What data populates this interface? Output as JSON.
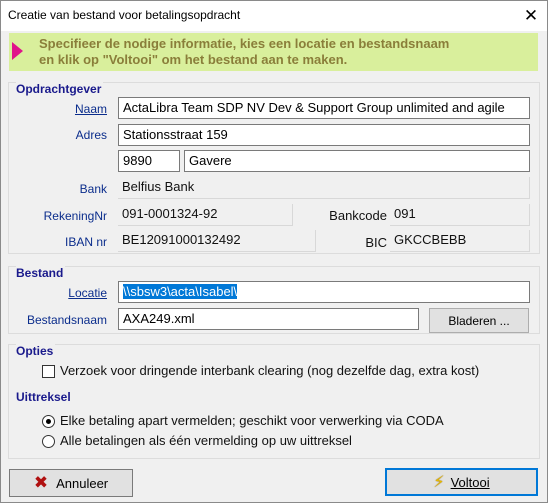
{
  "window": {
    "title": "Creatie van bestand voor betalingsopdracht"
  },
  "banner": {
    "text": "Specifieer de nodige informatie, kies een locatie en bestandsnaam\nen klik op \"Voltooi\" om het bestand aan te maken."
  },
  "opdrachtgever": {
    "title": "Opdrachtgever",
    "naam_label": "Naam",
    "naam_value": "ActaLibra Team SDP NV Dev & Support Group unlimited and agile",
    "adres_label": "Adres",
    "adres_value": "Stationsstraat 159",
    "postcode_value": "9890",
    "gemeente_value": "Gavere",
    "bank_label": "Bank",
    "bank_value": "Belfius Bank",
    "rekening_label": "RekeningNr",
    "rekening_value": "091-0001324-92",
    "bankcode_label": "Bankcode",
    "bankcode_value": "091",
    "iban_label": "IBAN nr",
    "iban_value": "BE12091000132492",
    "bic_label": "BIC",
    "bic_value": "GKCCBEBB"
  },
  "bestand": {
    "title": "Bestand",
    "locatie_label": "Locatie",
    "locatie_value": "\\\\sbsw3\\acta\\Isabel\\",
    "naam_label": "Bestandsnaam",
    "naam_value": "AXA249.xml",
    "browse_label": "Bladeren ..."
  },
  "opties": {
    "title": "Opties",
    "checkbox_label": "Verzoek voor dringende interbank clearing (nog dezelfde dag, extra kost)",
    "checkbox_checked": false
  },
  "uittreksel": {
    "title": "Uittreksel",
    "options": [
      {
        "label": "Elke betaling apart vermelden; geschikt voor verwerking via CODA",
        "selected": true
      },
      {
        "label": "Alle betalingen als één vermelding op uw uittreksel",
        "selected": false
      }
    ]
  },
  "footer": {
    "cancel_label": "Annuleer",
    "finish_label": "Voltooi"
  },
  "icons": {
    "close": "close-icon",
    "arrow": "arrow-icon",
    "cancel": "x-icon",
    "finish": "lightning-icon"
  },
  "colors": {
    "banner_bg": "#d9ef9c",
    "banner_text": "#8a7e3a",
    "arrow": "#e0148a",
    "label_blue": "#0b2d8c",
    "selection": "#0078d7"
  }
}
